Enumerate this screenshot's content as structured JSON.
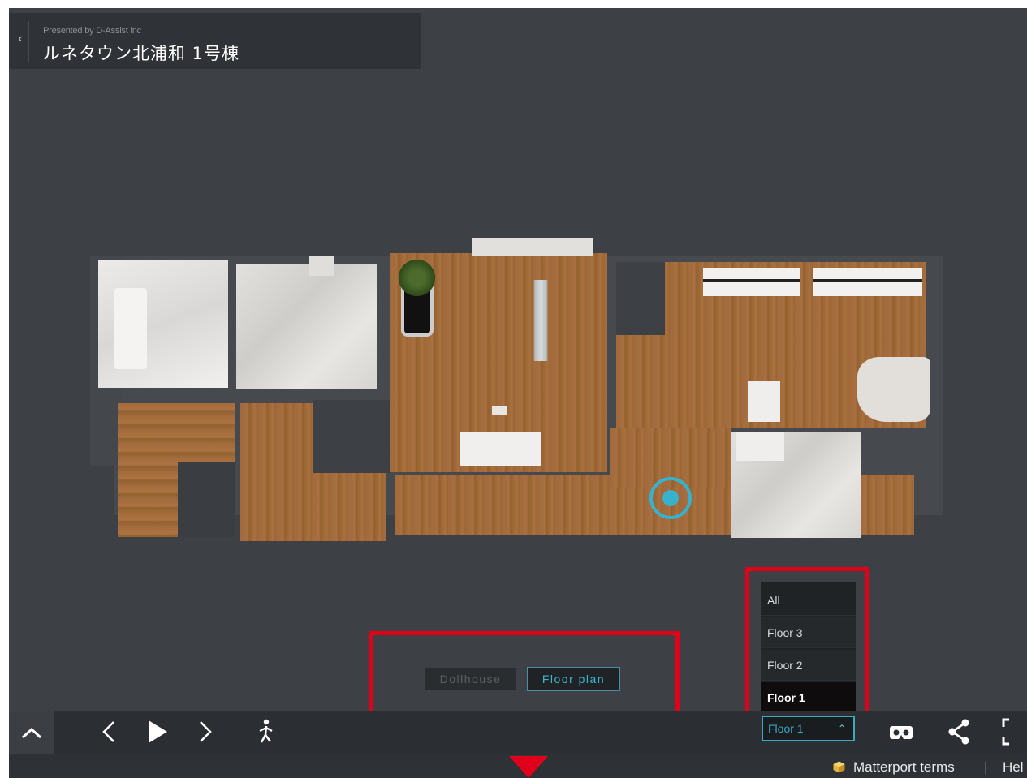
{
  "header": {
    "presented_by": "Presented by D-Assist inc",
    "title": "ルネタウン北浦和 1号棟"
  },
  "view_modes": {
    "dollhouse": "Dollhouse",
    "floor_plan": "Floor plan",
    "active": "Floor plan"
  },
  "floor_menu": {
    "options": [
      "All",
      "Floor 3",
      "Floor 2",
      "Floor 1"
    ],
    "selected": "Floor 1",
    "select_value": "Floor 1"
  },
  "toolbar": {
    "icons": [
      "chevron-up-icon",
      "previous-icon",
      "play-icon",
      "next-icon",
      "walk-icon",
      "vr-headset-icon",
      "share-icon",
      "fullscreen-icon"
    ]
  },
  "footer": {
    "terms": "Matterport terms",
    "separator": "|",
    "help": "Hel"
  },
  "colors": {
    "accent": "#3aa9c2",
    "callout": "#e0001a",
    "viewport_bg": "#3d4145"
  }
}
